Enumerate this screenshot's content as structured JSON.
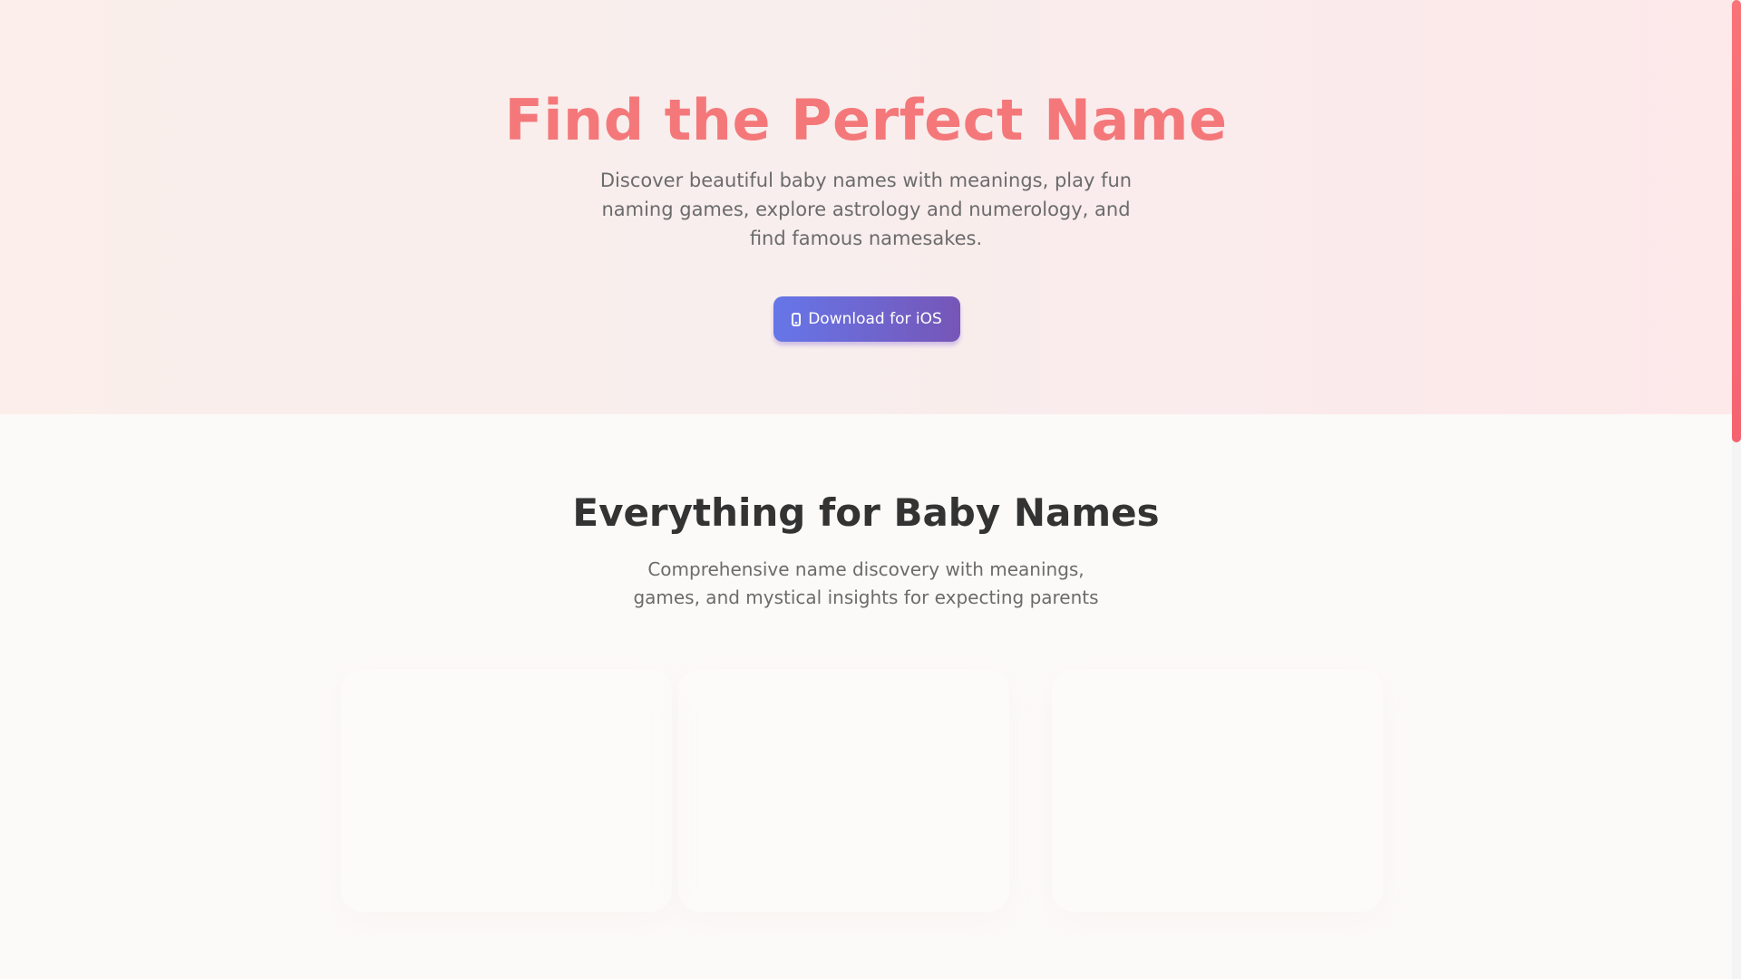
{
  "hero": {
    "title": "Find the Perfect Name",
    "subtitle": "Discover beautiful baby names with meanings, play fun naming games, explore astrology and numerology, and find famous namesakes.",
    "download_button_label": "Download for iOS",
    "download_button_icon": "phone-icon"
  },
  "features": {
    "title": "Everything for Baby Names",
    "subtitle": "Comprehensive name discovery with meanings, games, and mystical insights for expecting parents"
  },
  "colors": {
    "accent": "#f4787a",
    "button_start": "#6676e8",
    "button_end": "#7656b7",
    "heading": "#333333",
    "body_text": "#6b6b6b"
  }
}
